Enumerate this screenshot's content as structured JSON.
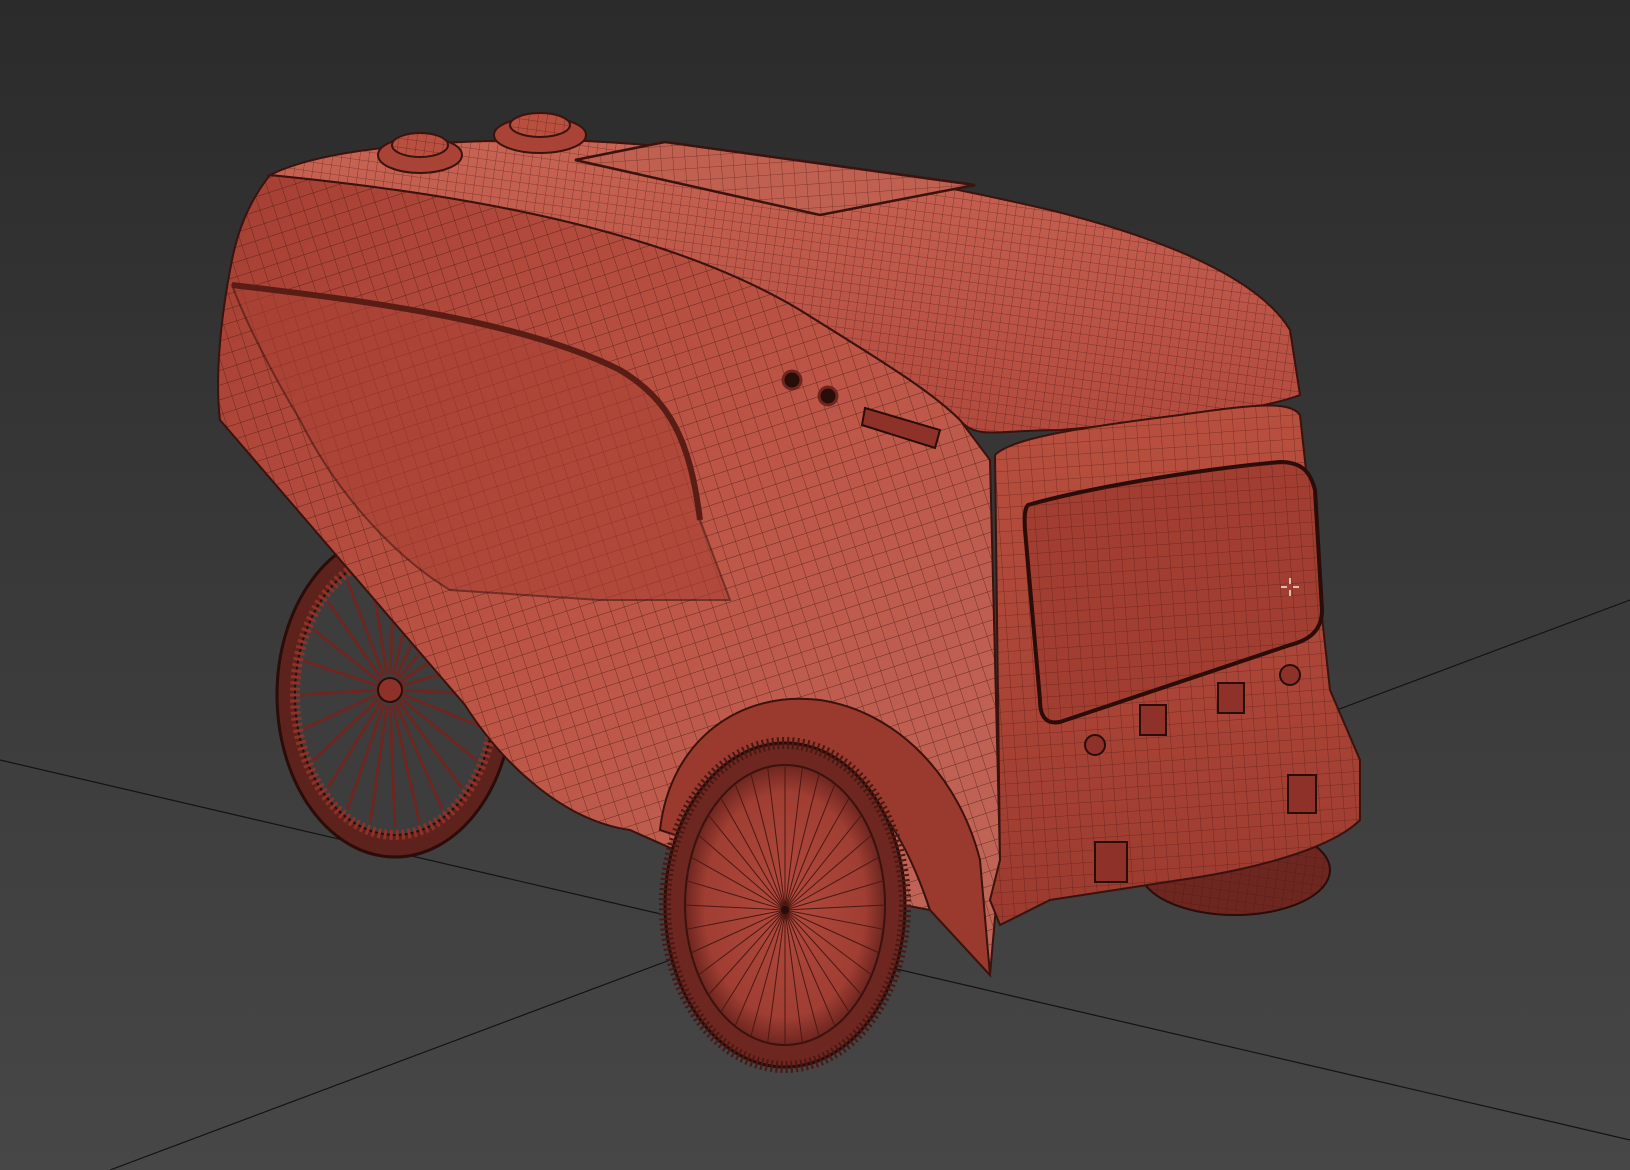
{
  "viewport": {
    "mode": "perspective",
    "shading": "wireframe-on-shaded",
    "background_top": "#2b2b2b",
    "background_bottom": "#474747",
    "grid_line_color": "#121212"
  },
  "model": {
    "name": "delivery-robot",
    "shell_color": "#b24a3e",
    "shell_highlight": "#c86a5a",
    "shell_shadow": "#6e2620",
    "wire_color": "#3a120e"
  },
  "cursor": {
    "icon": "crosshair-cursor-icon"
  }
}
